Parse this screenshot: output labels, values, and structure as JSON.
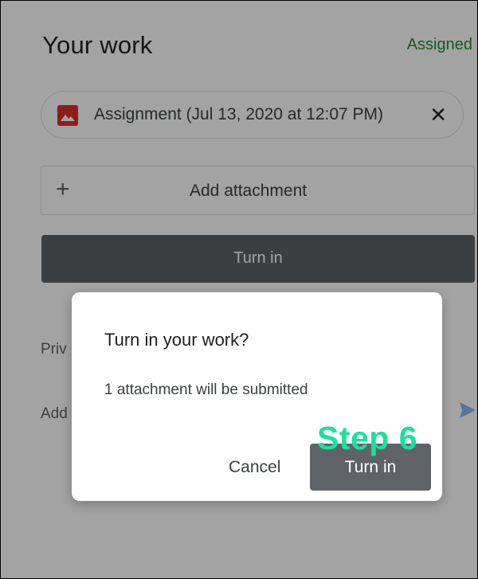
{
  "header": {
    "title": "Your work",
    "status": "Assigned"
  },
  "attachment_chip": {
    "label": "Assignment (Jul 13, 2020 at 12:07 PM)",
    "close_symbol": "✕",
    "icon": "image-file-icon"
  },
  "add_attachment": {
    "plus_symbol": "+",
    "label": "Add attachment"
  },
  "turn_in_button": {
    "label": "Turn in"
  },
  "background_fields": {
    "private_comments_partial": "Priv",
    "add_comment_partial": "Add"
  },
  "dialog": {
    "title": "Turn in your work?",
    "message": "1 attachment will be submitted",
    "cancel_label": "Cancel",
    "confirm_label": "Turn in"
  },
  "annotation": {
    "label": "Step 6",
    "color": "#19e29a"
  },
  "colors": {
    "status_green": "#1e8e3e",
    "button_gray": "#5f6368",
    "image_icon_red": "#d93025"
  }
}
